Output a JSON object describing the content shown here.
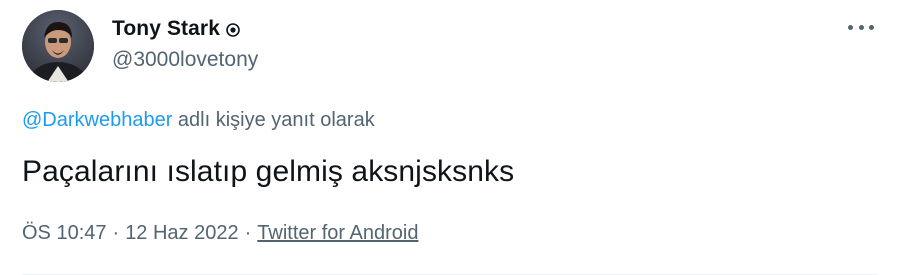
{
  "author": {
    "display_name": "Tony Stark",
    "handle": "@3000lovetony",
    "avatar_icon": "profile-photo",
    "badge_icon": "verified-badge-icon"
  },
  "menu": {
    "icon": "more-options-icon"
  },
  "reply": {
    "mention": "@Darkwebhaber",
    "suffix": " adlı kişiye yanıt olarak"
  },
  "tweet": {
    "text": "Paçalarını ıslatıp gelmiş aksnjsksnks"
  },
  "meta": {
    "time": "ÖS 10:47",
    "separator": "·",
    "date": "12 Haz 2022",
    "source": "Twitter for Android"
  },
  "colors": {
    "primary_text": "#0f1419",
    "secondary_text": "#536471",
    "link": "#1d9bf0",
    "divider": "#eff3f4"
  }
}
